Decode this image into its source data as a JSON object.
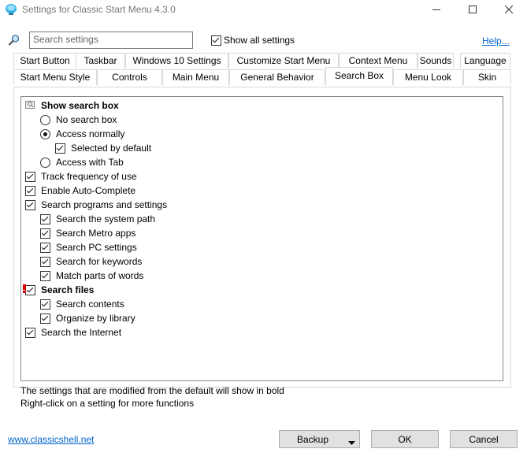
{
  "window": {
    "title": "Settings for Classic Start Menu 4.3.0"
  },
  "toolbar": {
    "search_placeholder": "Search settings",
    "show_all_label": "Show all settings",
    "show_all_checked": true,
    "help_label": "Help..."
  },
  "tabs_row1": [
    "Start Button",
    "Taskbar",
    "Windows 10 Settings",
    "Customize Start Menu",
    "Context Menu",
    "Sounds",
    "Language"
  ],
  "tabs_row2": [
    "Start Menu Style",
    "Controls",
    "Main Menu",
    "General Behavior",
    "Search Box",
    "Menu Look",
    "Skin"
  ],
  "active_tab": "Search Box",
  "settings": [
    {
      "label": "Show search box",
      "kind": "header",
      "bold": true,
      "level": 0
    },
    {
      "label": "No search box",
      "kind": "radio",
      "checked": false,
      "level": 1
    },
    {
      "label": "Access normally",
      "kind": "radio",
      "checked": true,
      "level": 1
    },
    {
      "label": "Selected by default",
      "kind": "check",
      "checked": true,
      "level": 2
    },
    {
      "label": "Access with Tab",
      "kind": "radio",
      "checked": false,
      "level": 1
    },
    {
      "label": "Track frequency of use",
      "kind": "check",
      "checked": true,
      "level": 0
    },
    {
      "label": "Enable Auto-Complete",
      "kind": "check",
      "checked": true,
      "level": 0
    },
    {
      "label": "Search programs and settings",
      "kind": "check",
      "checked": true,
      "level": 0
    },
    {
      "label": "Search the system path",
      "kind": "check",
      "checked": true,
      "level": 1
    },
    {
      "label": "Search Metro apps",
      "kind": "check",
      "checked": true,
      "level": 1
    },
    {
      "label": "Search PC settings",
      "kind": "check",
      "checked": true,
      "level": 1
    },
    {
      "label": "Search for keywords",
      "kind": "check",
      "checked": true,
      "level": 1
    },
    {
      "label": "Match parts of words",
      "kind": "check",
      "checked": true,
      "level": 1
    },
    {
      "label": "Search files",
      "kind": "check",
      "checked": true,
      "bold": true,
      "modified": true,
      "level": 0
    },
    {
      "label": "Search contents",
      "kind": "check",
      "checked": true,
      "level": 1
    },
    {
      "label": "Organize by library",
      "kind": "check",
      "checked": true,
      "level": 1
    },
    {
      "label": "Search the Internet",
      "kind": "check",
      "checked": true,
      "level": 0
    }
  ],
  "footer": {
    "note_line1": "The settings that are modified from the default will show in bold",
    "note_line2": "Right-click on a setting for more functions",
    "link": "www.classicshell.net",
    "backup_label": "Backup",
    "ok_label": "OK",
    "cancel_label": "Cancel"
  },
  "colors": {
    "link": "#0066cc",
    "modified_marker": "#e00000"
  },
  "icons": {
    "app": "classic-shell-icon",
    "search": "magnifier-icon",
    "header": "search-box-icon",
    "modified": "modified-marker-icon"
  }
}
